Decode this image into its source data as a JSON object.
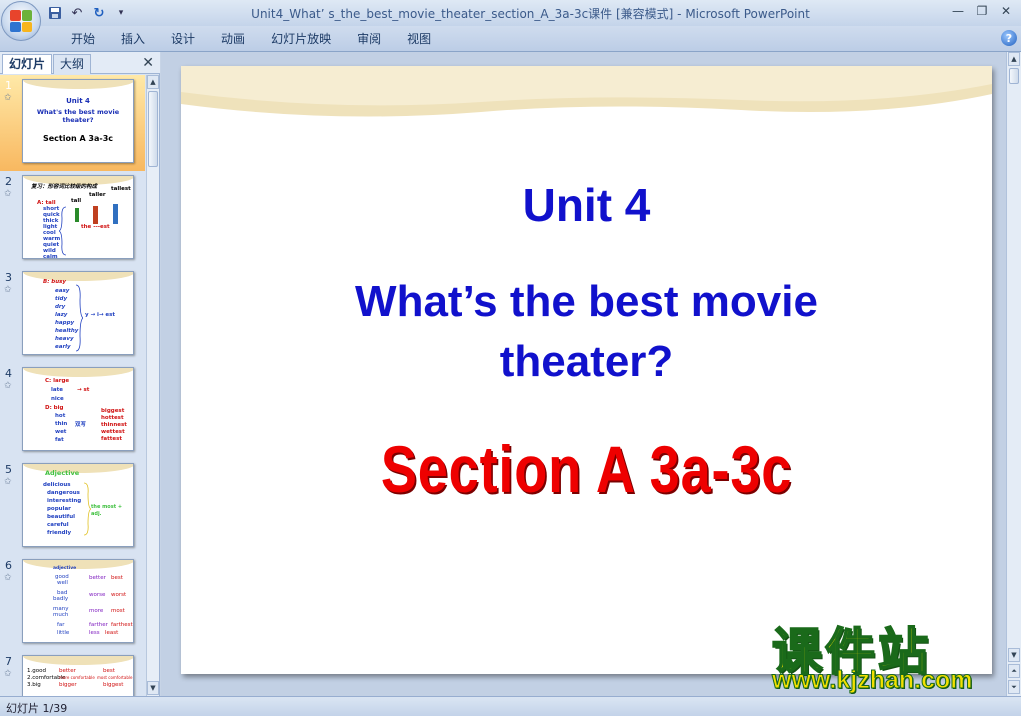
{
  "window": {
    "title": "Unit4_What’ s_the_best_movie_theater_section_A_3a-3c课件 [兼容模式] - Microsoft PowerPoint"
  },
  "ribbon": {
    "tabs": [
      "开始",
      "插入",
      "设计",
      "动画",
      "幻灯片放映",
      "审阅",
      "视图"
    ]
  },
  "panel": {
    "tab_slides": "幻灯片",
    "tab_outline": "大纲",
    "thumbnails": [
      {
        "num": "1",
        "lines": [
          "Unit 4",
          "What's the best movie",
          "theater?",
          "Section A  3a-3c"
        ]
      },
      {
        "num": "2",
        "lines": [
          "复习：形容词比较级的构成",
          "A: tall",
          "short",
          "quick",
          "thick",
          "light",
          "cool",
          "warm",
          "quiet",
          "wild",
          "calm",
          "tall",
          "taller",
          "tallest",
          "the ---est"
        ]
      },
      {
        "num": "3",
        "lines": [
          "B: busy",
          "easy",
          "tidy",
          "dry",
          "lazy",
          "happy",
          "healthy",
          "heavy",
          "early",
          "y → i→ est"
        ]
      },
      {
        "num": "4",
        "lines": [
          "C: large",
          "late",
          "nice",
          "→ st",
          "D: big",
          "hot",
          "thin",
          "wet",
          "fat",
          "双写",
          "biggest",
          "hottest",
          "thinnest",
          "wettest",
          "fattest"
        ]
      },
      {
        "num": "5",
        "lines": [
          "Adjective",
          "delicious",
          "dangerous",
          "interesting",
          "popular",
          "beautiful",
          "careful",
          "friendly",
          "the most + adj."
        ]
      },
      {
        "num": "6",
        "lines": [
          "adjective",
          "good",
          "well",
          "better",
          "best",
          "bad",
          "badly",
          "worse",
          "worst",
          "many",
          "much",
          "more",
          "most",
          "far",
          "farther",
          "farthest",
          "little",
          "less",
          "least"
        ]
      },
      {
        "num": "7",
        "lines": [
          "1.good",
          "2.comfortable",
          "3.big",
          "better",
          "more comfortable",
          "bigger",
          "best",
          "most comfortable",
          "biggest"
        ]
      }
    ]
  },
  "slide": {
    "title_line1": "Unit 4",
    "title_line2a": "What’s the best movie",
    "title_line2b": "theater?",
    "section": "Section A  3a-3c"
  },
  "status": {
    "text": "幻灯片 1/39"
  },
  "watermark": {
    "cn": "课件站",
    "url": "www.kjzhan.com"
  },
  "colors": {
    "title_blue": "#1111cc",
    "section_red": "#ee0000",
    "watermark_yellow": "#f2e000",
    "watermark_green": "#1a6a1a"
  }
}
